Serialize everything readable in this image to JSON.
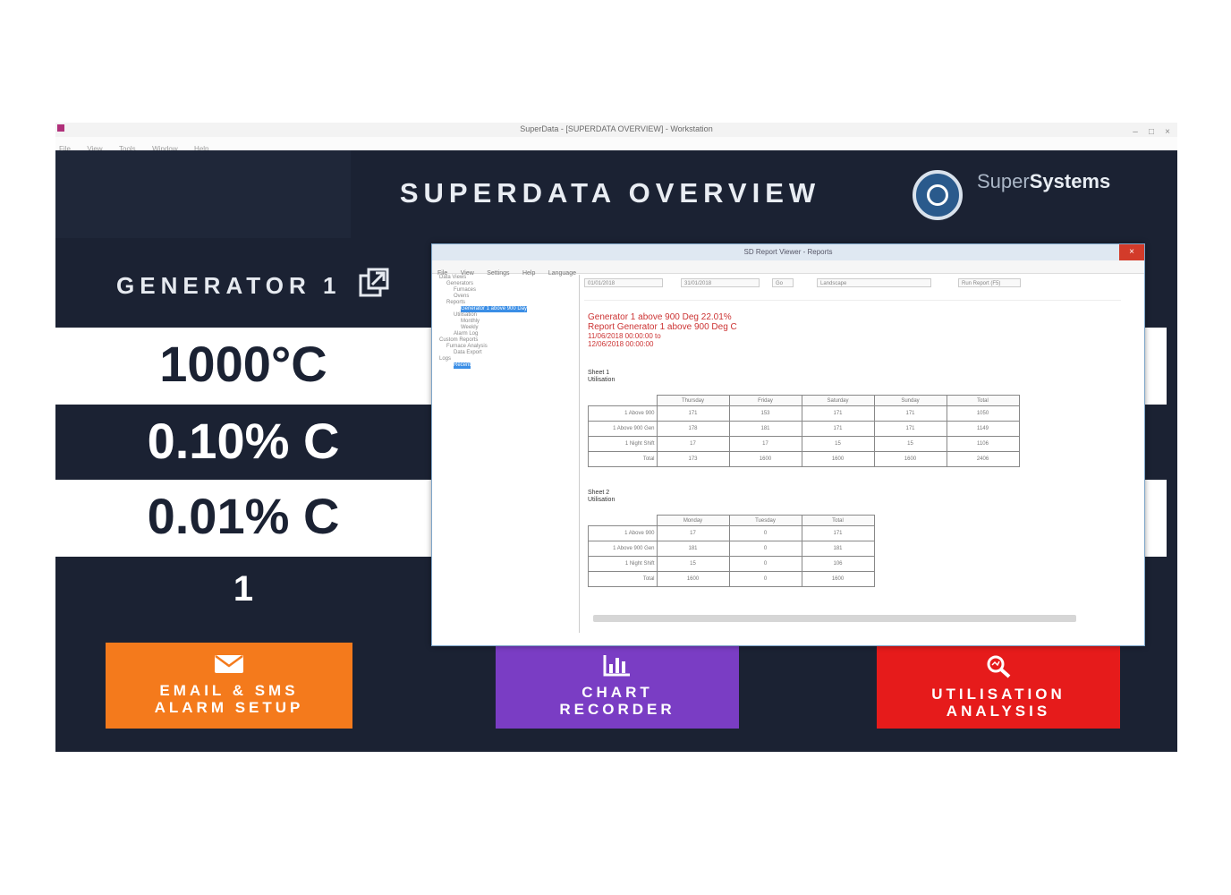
{
  "window": {
    "title": "SuperData - [SUPERDATA OVERVIEW] - Workstation",
    "menu": [
      "File",
      "View",
      "Tools",
      "Window",
      "Help"
    ]
  },
  "header": {
    "title": "SUPERDATA OVERVIEW",
    "logo_light": "Super",
    "logo_bold": "Systems"
  },
  "generator": {
    "title": "GENERATOR 1",
    "icon": "popout-icon"
  },
  "readings": [
    "1000°C",
    "0.10% C",
    "0.01% C",
    "1"
  ],
  "buttons": {
    "email": {
      "line1": "EMAIL & SMS",
      "line2": "ALARM SETUP",
      "icon": "email-icon",
      "color": "#f47a1c"
    },
    "chart": {
      "line1": "CHART",
      "line2": "RECORDER",
      "icon": "bar-chart-icon",
      "color": "#7a3dc4"
    },
    "util": {
      "line1": "UTILISATION",
      "line2": "ANALYSIS",
      "icon": "magnifier-icon",
      "color": "#e61b1b"
    }
  },
  "popup": {
    "title": "SD Report Viewer - Reports",
    "menu": [
      "File",
      "View",
      "Settings",
      "Help",
      "Language"
    ],
    "tree": [
      "Data Views",
      "Generators",
      "Furnaces",
      "Ovens",
      "Reports",
      "Generator 1 above 900 Day",
      "Utilisation",
      "Monthly",
      "Weekly",
      "Alarm Log",
      "Custom Reports",
      "Furnace Analysis",
      "Data Export",
      "Logs",
      "Recent"
    ],
    "tree_selected": [
      5,
      14
    ],
    "toolbar": {
      "start": "01/01/2018",
      "end": "31/01/2018",
      "go": "Go",
      "layout": "Landscape",
      "refresh": "Run Report (F5)"
    },
    "report_lines": [
      "Generator 1 above 900 Deg 22.01%",
      "Report Generator 1 above 900 Deg C"
    ],
    "report_dates": [
      "11/06/2018 00:00:00 to",
      "12/06/2018 00:00:00"
    ],
    "sheet1": {
      "title": "Sheet 1",
      "subtitle": "Utilisation",
      "headers": [
        "",
        "Thursday",
        "Friday",
        "Saturday",
        "Sunday",
        "Total"
      ],
      "rows": [
        [
          "1 Above 900",
          "171",
          "153",
          "171",
          "171",
          "1050"
        ],
        [
          "1 Above 900 Gen",
          "178",
          "181",
          "171",
          "171",
          "1149"
        ],
        [
          "1 Night Shift",
          "17",
          "17",
          "15",
          "15",
          "1106"
        ],
        [
          "Total",
          "173",
          "1600",
          "1600",
          "1600",
          "2406"
        ]
      ]
    },
    "sheet2": {
      "title": "Sheet 2",
      "subtitle": "Utilisation",
      "headers": [
        "",
        "Monday",
        "Tuesday",
        "Total"
      ],
      "rows": [
        [
          "1 Above 900",
          "17",
          "0",
          "171"
        ],
        [
          "1 Above 900 Gen",
          "181",
          "0",
          "181"
        ],
        [
          "1 Night Shift",
          "15",
          "0",
          "106"
        ],
        [
          "Total",
          "1600",
          "0",
          "1600"
        ]
      ]
    }
  }
}
